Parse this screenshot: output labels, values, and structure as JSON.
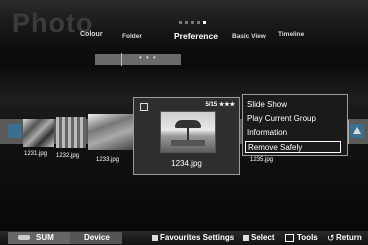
{
  "header": {
    "title": "Photo",
    "tabs": {
      "colour": "Colour",
      "folder": "Folder",
      "preference": "Preference",
      "basic_view": "Basic View",
      "timeline": "Timeline"
    },
    "page_dots": 5,
    "active_dot": 5
  },
  "group_bar": {
    "indicator": "• • •"
  },
  "thumbnails": [
    {
      "caption": "1231.jpg"
    },
    {
      "caption": "1232.jpg"
    },
    {
      "caption": "1233.jpg"
    },
    {
      "caption": "1235.jpg"
    }
  ],
  "selected": {
    "position": "5/15",
    "rating": "★★★",
    "filename": "1234.jpg"
  },
  "context_menu": {
    "items": [
      "Slide Show",
      "Play Current Group",
      "Information",
      "Remove Safely"
    ],
    "selected_index": 3
  },
  "bottom_bar": {
    "sum_label": "SUM",
    "device_label": "Device",
    "favourites_label": "Favourites Settings",
    "select_label": "Select",
    "tools_label": "Tools",
    "return_label": "Return"
  }
}
